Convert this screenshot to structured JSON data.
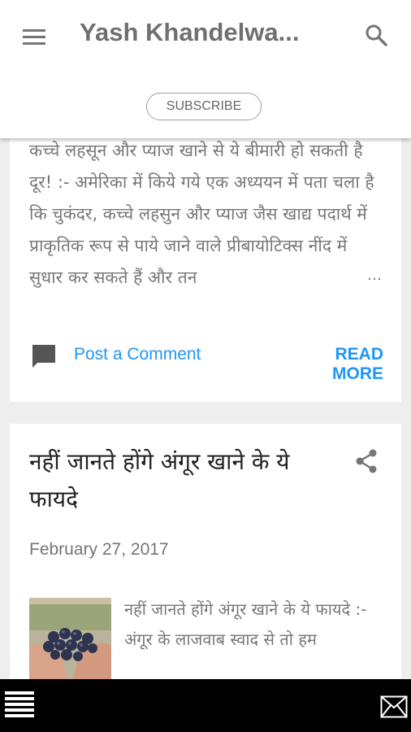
{
  "header": {
    "menu_icon": "hamburger-menu-icon",
    "site_title": "Yash Khandelwa...",
    "search_icon": "search-icon",
    "subscribe_label": "SUBSCRIBE"
  },
  "posts": [
    {
      "snippet": "कच्चे लहसून और प्याज खाने से ये बीमारी हो सकती है दूर! :- अमेरिका में किये गये एक अध्ययन में पता चला है कि चुकंदर, कच्चे लहसुन और प्याज जैस खाद्य पदार्थ में प्राकृतिक रूप से पाये जाने वाले प्रीबायोटिक्स नींद में सुधार कर सकते हैं और तन",
      "ellipsis": "…",
      "comment_icon": "comment-icon",
      "comment_label": "Post a Comment",
      "read_more_label": "READ MORE"
    },
    {
      "title": "नहीं जानते होंगे अंगूर खाने के ये फायदे",
      "share_icon": "share-icon",
      "date": "February 27, 2017",
      "thumbnail_icon": "grapes-in-hands-image",
      "snippet": "नहीं जानते होंगे अंगूर खाने के ये फायदे :- अंगूर के लाजवाब स्वाद से तो हम"
    }
  ],
  "bottom_bar": {
    "menu_icon": "bottom-menu-icon",
    "mail_icon": "mail-icon"
  },
  "colors": {
    "accent": "#2196f3",
    "bottom_bar": "#000000",
    "page_bg": "#eeeeee"
  }
}
